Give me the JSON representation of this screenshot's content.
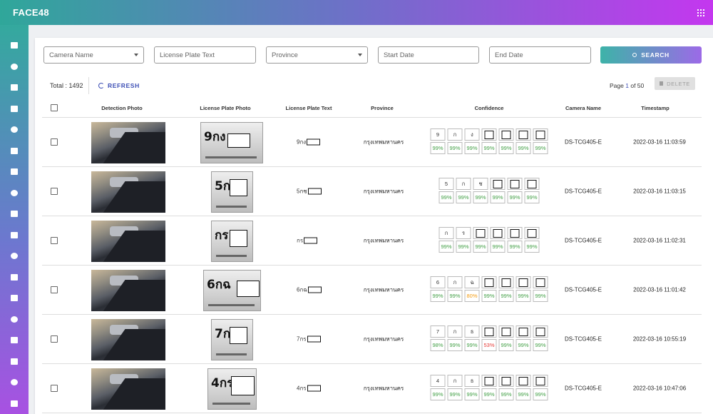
{
  "app": {
    "title": "FACE48"
  },
  "colors": {
    "accent": "#3d4fb5",
    "ok": "#43a047",
    "warn": "#f39c12",
    "bad": "#e53935"
  },
  "sidebar": {
    "items": [
      {
        "icon": "contact-card-icon"
      },
      {
        "icon": "add-person-icon"
      },
      {
        "icon": "building-layout-icon"
      },
      {
        "icon": "bar-chart-icon"
      },
      {
        "icon": "calendar-icon"
      },
      {
        "icon": "clock-icon"
      },
      {
        "icon": "chat-icon"
      },
      {
        "icon": "alert-light-icon"
      },
      {
        "icon": "document-list-icon"
      },
      {
        "icon": "office-icon"
      },
      {
        "icon": "city-icon"
      },
      {
        "icon": "family-icon"
      },
      {
        "icon": "graduation-icon"
      },
      {
        "icon": "network-icon"
      },
      {
        "icon": "monitor-icon"
      },
      {
        "icon": "location-pin-icon"
      },
      {
        "icon": "id-badge-icon"
      },
      {
        "icon": "table-icon"
      }
    ]
  },
  "filters": {
    "camera_name": "Camera Name",
    "plate_text": "License Plate Text",
    "province": "Province",
    "start_date": "Start Date",
    "end_date": "End Date",
    "search_label": "SEARCH"
  },
  "toolbar": {
    "total": "Total : 1492",
    "refresh_label": "REFRESH",
    "page_prefix": "Page",
    "page_current": "1",
    "page_suffix": "of 50",
    "delete_label": "DELETE"
  },
  "table": {
    "columns": [
      "Detection Photo",
      "License Plate Photo",
      "License Plate Text",
      "Province",
      "Confidence",
      "Camera Name",
      "Timestamp"
    ],
    "rows": [
      {
        "plate_chars": "9กง",
        "plate_text": "9กง",
        "province": "กรุงเทพมหานคร",
        "camera": "DS-TCG405-E",
        "timestamp": "2022-03-16 11:03:59",
        "conf": [
          [
            "9",
            "99%"
          ],
          [
            "ก",
            "99%"
          ],
          [
            "ง",
            "99%"
          ],
          [
            "",
            "99%"
          ],
          [
            "",
            "99%"
          ],
          [
            "",
            "99%"
          ],
          [
            "",
            "99%"
          ]
        ]
      },
      {
        "plate_chars": "5กช",
        "plate_text": "5กช",
        "province": "กรุงเทพมหานคร",
        "camera": "DS-TCG405-E",
        "timestamp": "2022-03-16 11:03:15",
        "conf": [
          [
            "5",
            "99%"
          ],
          [
            "ก",
            "99%"
          ],
          [
            "ช",
            "99%"
          ],
          [
            "",
            "99%"
          ],
          [
            "",
            "99%"
          ],
          [
            "",
            "99%"
          ]
        ]
      },
      {
        "plate_chars": "กร",
        "plate_text": "กร",
        "province": "กรุงเทพมหานคร",
        "camera": "DS-TCG405-E",
        "timestamp": "2022-03-16 11:02:31",
        "conf": [
          [
            "ก",
            "99%"
          ],
          [
            "ร",
            "99%"
          ],
          [
            "",
            "99%"
          ],
          [
            "",
            "99%"
          ],
          [
            "",
            "99%"
          ],
          [
            "",
            "99%"
          ]
        ]
      },
      {
        "plate_chars": "6กฉ",
        "plate_text": "6กฉ",
        "province": "กรุงเทพมหานคร",
        "camera": "DS-TCG405-E",
        "timestamp": "2022-03-16 11:01:42",
        "conf": [
          [
            "6",
            "99%"
          ],
          [
            "ก",
            "99%"
          ],
          [
            "ฉ",
            "80%"
          ],
          [
            "",
            "99%"
          ],
          [
            "",
            "99%"
          ],
          [
            "",
            "99%"
          ],
          [
            "",
            "99%"
          ]
        ]
      },
      {
        "plate_chars": "7กร",
        "plate_text": "7กร",
        "province": "กรุงเทพมหานคร",
        "camera": "DS-TCG405-E",
        "timestamp": "2022-03-16 10:55:19",
        "conf": [
          [
            "7",
            "98%"
          ],
          [
            "ก",
            "99%"
          ],
          [
            "ธ",
            "99%"
          ],
          [
            "",
            "53%"
          ],
          [
            "",
            "99%"
          ],
          [
            "",
            "99%"
          ],
          [
            "",
            "99%"
          ]
        ]
      },
      {
        "plate_chars": "4กร",
        "plate_text": "4กร",
        "province": "กรุงเทพมหานคร",
        "camera": "DS-TCG405-E",
        "timestamp": "2022-03-16 10:47:06",
        "conf": [
          [
            "4",
            "99%"
          ],
          [
            "ก",
            "99%"
          ],
          [
            "ธ",
            "99%"
          ],
          [
            "",
            "99%"
          ],
          [
            "",
            "99%"
          ],
          [
            "",
            "99%"
          ],
          [
            "",
            "99%"
          ]
        ]
      }
    ]
  }
}
